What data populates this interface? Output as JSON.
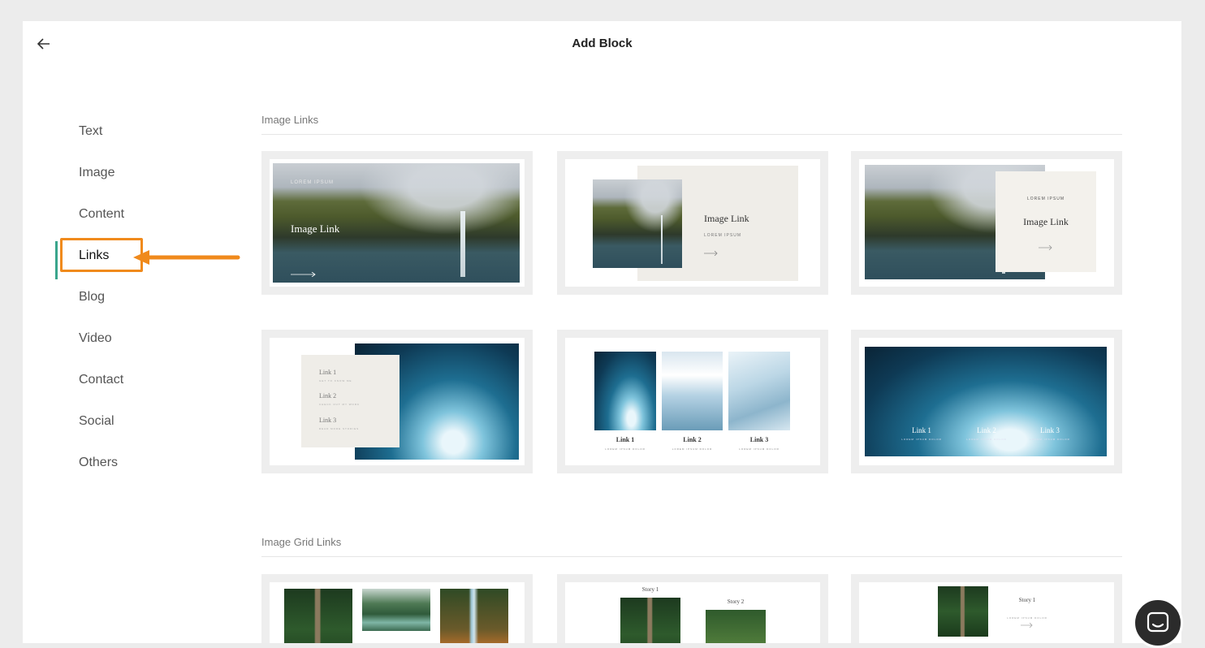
{
  "header": {
    "title": "Add Block",
    "back_icon": "arrow-left-icon"
  },
  "sidebar": {
    "items": [
      {
        "label": "Text"
      },
      {
        "label": "Image"
      },
      {
        "label": "Content"
      },
      {
        "label": "Links",
        "active": true
      },
      {
        "label": "Blog"
      },
      {
        "label": "Video"
      },
      {
        "label": "Contact"
      },
      {
        "label": "Social"
      },
      {
        "label": "Others"
      }
    ]
  },
  "sections": {
    "image_links": {
      "title": "Image Links",
      "card1": {
        "eyebrow": "LOREM IPSUM",
        "heading": "Image Link"
      },
      "card2": {
        "heading": "Image Link",
        "sub": "LOREM IPSUM"
      },
      "card3": {
        "eyebrow": "LOREM IPSUM",
        "heading": "Image Link"
      },
      "card4": {
        "links": [
          {
            "label": "Link 1",
            "sub": "GET TO KNOW ME"
          },
          {
            "label": "Link 2",
            "sub": "CHECK OUT MY WORK"
          },
          {
            "label": "Link 3",
            "sub": "READ MORE STORIES"
          }
        ]
      },
      "card5": {
        "links": [
          {
            "label": "Link 1",
            "sub": "LOREM IPSUM DOLOR"
          },
          {
            "label": "Link 2",
            "sub": "LOREM IPSUM DOLOR"
          },
          {
            "label": "Link 3",
            "sub": "LOREM IPSUM DOLOR"
          }
        ]
      },
      "card6": {
        "links": [
          {
            "label": "Link 1",
            "sub": "LOREM IPSUM DOLOR"
          },
          {
            "label": "Link 2",
            "sub": "LOREM IPSUM DOLOR"
          },
          {
            "label": "Link 3",
            "sub": "LOREM IPSUM DOLOR"
          }
        ]
      }
    },
    "image_grid_links": {
      "title": "Image Grid Links",
      "card2": {
        "story1": "Story 1",
        "story2": "Story 2"
      },
      "card3": {
        "story1": "Story 1",
        "sub": "LOREM IPSUM DOLOR"
      }
    }
  },
  "annotation": {
    "highlight_color": "#f08a1c",
    "accent_color": "#3aa58c"
  },
  "chat": {
    "icon": "chat-bubble-icon"
  }
}
